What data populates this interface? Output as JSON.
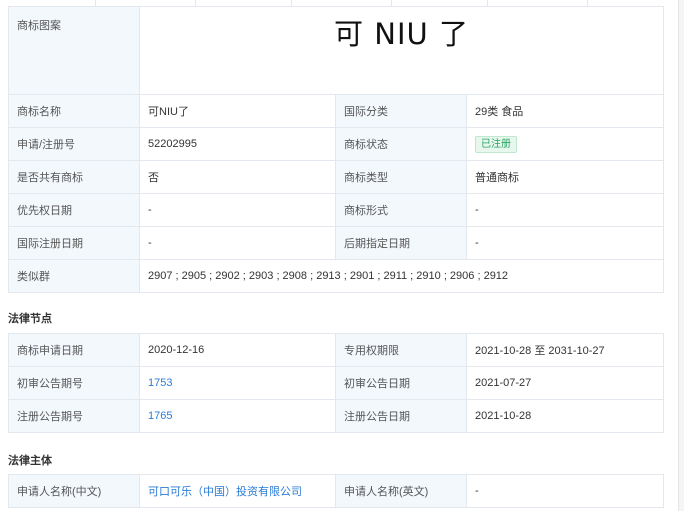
{
  "basic": {
    "logo_label": "商标图案",
    "logo_text": "可 NIU 了",
    "name_label": "商标名称",
    "name": "可NIU了",
    "class_label": "国际分类",
    "class_value": "29类 食品",
    "reg_no_label": "申请/注册号",
    "reg_no": "52202995",
    "status_label": "商标状态",
    "status": "已注册",
    "shared_label": "是否共有商标",
    "shared": "否",
    "type_label": "商标类型",
    "type": "普通商标",
    "priority_label": "优先权日期",
    "priority": "-",
    "form_label": "商标形式",
    "form": "-",
    "intl_date_label": "国际注册日期",
    "intl_date": "-",
    "later_date_label": "后期指定日期",
    "later_date": "-",
    "similar_label": "类似群",
    "similar": "2907 ; 2905 ; 2902 ; 2903 ; 2908 ; 2913 ; 2901 ; 2911 ; 2910 ; 2906 ; 2912"
  },
  "legal": {
    "title": "法律节点",
    "apply_date_label": "商标申请日期",
    "apply_date": "2020-12-16",
    "exclusive_label": "专用权期限",
    "exclusive": "2021-10-28 至 2031-10-27",
    "prelim_no_label": "初审公告期号",
    "prelim_no": "1753",
    "prelim_date_label": "初审公告日期",
    "prelim_date": "2021-07-27",
    "reg_notice_no_label": "注册公告期号",
    "reg_notice_no": "1765",
    "reg_notice_date_label": "注册公告日期",
    "reg_notice_date": "2021-10-28"
  },
  "subject": {
    "title": "法律主体",
    "applicant_cn_label": "申请人名称(中文)",
    "applicant_cn": "可口可乐（中国）投资有限公司",
    "applicant_en_label": "申请人名称(英文)",
    "applicant_en": "-"
  }
}
